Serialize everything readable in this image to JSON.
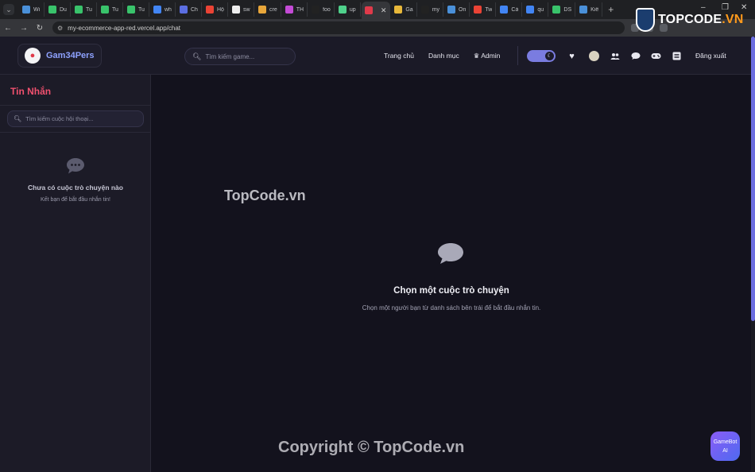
{
  "browser": {
    "tabs": [
      {
        "label": "Wi",
        "color": "#4a90d9"
      },
      {
        "label": "Du",
        "color": "#39c36b"
      },
      {
        "label": "Tu",
        "color": "#39c36b"
      },
      {
        "label": "Tu",
        "color": "#39c36b"
      },
      {
        "label": "Tu",
        "color": "#39c36b"
      },
      {
        "label": "wh",
        "color": "#4285f4"
      },
      {
        "label": "Ch",
        "color": "#5b6ee1"
      },
      {
        "label": "Hộ",
        "color": "#ea4335"
      },
      {
        "label": "sw",
        "color": "#eeeeee"
      },
      {
        "label": "cre",
        "color": "#e8a63a"
      },
      {
        "label": "TH",
        "color": "#c44bd6"
      },
      {
        "label": "foo",
        "color": "#222222"
      },
      {
        "label": "up",
        "color": "#4fd18b"
      },
      {
        "label": "",
        "color": "#e03a4a",
        "active": true
      },
      {
        "label": "Ga",
        "color": "#e8b83a"
      },
      {
        "label": "my",
        "color": "#222222"
      },
      {
        "label": "On",
        "color": "#4a90d9"
      },
      {
        "label": "Tw",
        "color": "#ea4335"
      },
      {
        "label": "Cá",
        "color": "#4285f4"
      },
      {
        "label": "qu",
        "color": "#4285f4"
      },
      {
        "label": "DS",
        "color": "#39c36b"
      },
      {
        "label": "Kiể",
        "color": "#4a90d9"
      }
    ],
    "url": "my-ecommerce-app-red.vercel.app/chat"
  },
  "watermark": {
    "logo_text_main": "TOPCODE",
    "logo_text_suffix": ".VN",
    "mid": "TopCode.vn",
    "bottom": "Copyright © TopCode.vn"
  },
  "header": {
    "logo": "Gam34Pers",
    "search_placeholder": "Tìm kiếm game...",
    "nav": {
      "home": "Trang chủ",
      "categories": "Danh mục",
      "admin": "♛ Admin"
    },
    "logout": "Đăng xuất"
  },
  "sidebar": {
    "title": "Tin Nhắn",
    "search_placeholder": "Tìm kiếm cuộc hội thoại...",
    "empty_title": "Chưa có cuộc trò chuyện nào",
    "empty_sub": "Kết bạn để bắt đầu nhắn tin!"
  },
  "main": {
    "title": "Chọn một cuộc trò chuyện",
    "subtitle": "Chọn một người bạn từ danh sách bên trái để bắt đầu nhắn tin."
  },
  "gamebot": {
    "line1": "GameBot",
    "line2": "AI"
  }
}
